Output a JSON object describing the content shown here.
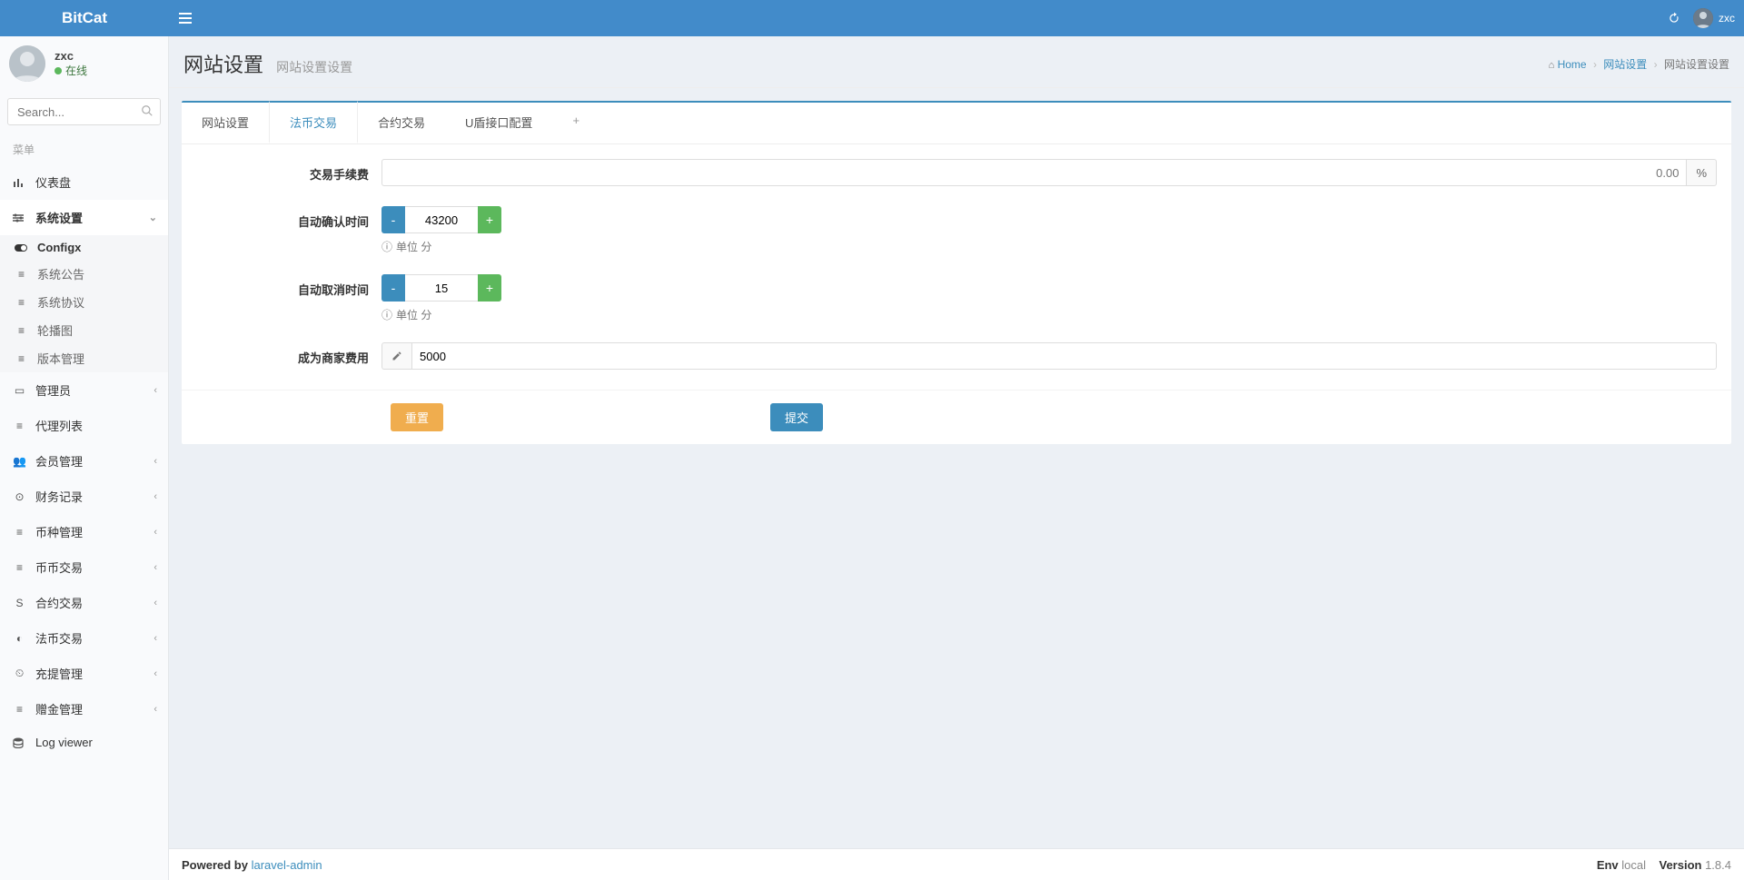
{
  "brand": "BitCat",
  "user": {
    "name": "zxc",
    "status": "在线"
  },
  "search": {
    "placeholder": "Search..."
  },
  "menuHeader": "菜单",
  "sidebar": [
    {
      "label": "仪表盘",
      "icon": "chart"
    },
    {
      "label": "系统设置",
      "icon": "sliders",
      "expanded": true,
      "children": [
        {
          "label": "Configx",
          "icon": "toggle",
          "active": true
        },
        {
          "label": "系统公告",
          "icon": "bars"
        },
        {
          "label": "系统协议",
          "icon": "bars"
        },
        {
          "label": "轮播图",
          "icon": "bars"
        },
        {
          "label": "版本管理",
          "icon": "bars"
        }
      ]
    },
    {
      "label": "管理员",
      "icon": "id"
    },
    {
      "label": "代理列表",
      "icon": "list"
    },
    {
      "label": "会员管理",
      "icon": "users"
    },
    {
      "label": "财务记录",
      "icon": "money"
    },
    {
      "label": "币种管理",
      "icon": "bars"
    },
    {
      "label": "币币交易",
      "icon": "bars"
    },
    {
      "label": "合约交易",
      "icon": "strike"
    },
    {
      "label": "法币交易",
      "icon": "contrast"
    },
    {
      "label": "充提管理",
      "icon": "gauge"
    },
    {
      "label": "赠金管理",
      "icon": "bars"
    },
    {
      "label": "Log viewer",
      "icon": "db"
    }
  ],
  "header": {
    "title": "网站设置",
    "subtitle": "网站设置设置",
    "breadcrumb": {
      "home": "Home",
      "parent": "网站设置",
      "current": "网站设置设置"
    }
  },
  "tabs": [
    {
      "label": "网站设置"
    },
    {
      "label": "法币交易"
    },
    {
      "label": "合约交易"
    },
    {
      "label": "U盾接口配置"
    }
  ],
  "form": {
    "fee": {
      "label": "交易手续费",
      "placeholder": "0.00",
      "unit": "%"
    },
    "confirm": {
      "label": "自动确认时间",
      "value": "43200",
      "hint": "单位 分",
      "minus": "-",
      "plus": "+"
    },
    "cancel": {
      "label": "自动取消时间",
      "value": "15",
      "hint": "单位 分",
      "minus": "-",
      "plus": "+"
    },
    "seller": {
      "label": "成为商家费用",
      "value": "5000"
    },
    "reset": "重置",
    "submit": "提交"
  },
  "footer": {
    "poweredBy": "Powered by",
    "link": "laravel-admin",
    "envLabel": "Env",
    "env": "local",
    "versionLabel": "Version",
    "version": "1.8.4"
  }
}
